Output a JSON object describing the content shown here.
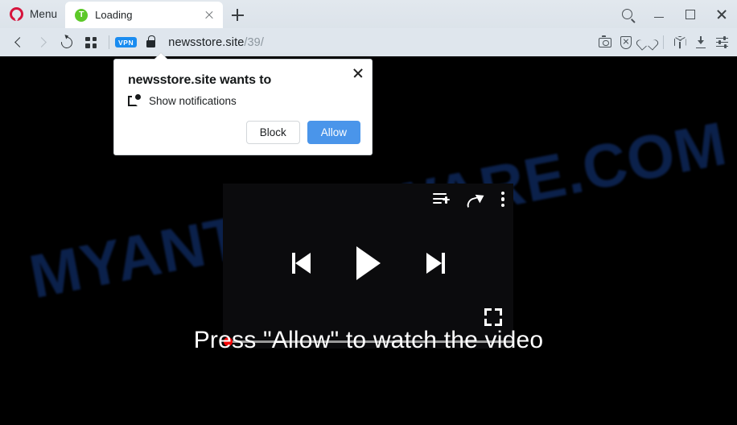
{
  "browser": {
    "menu_label": "Menu",
    "tab": {
      "title": "Loading",
      "favicon_letter": "T",
      "favicon_color": "#5cc928",
      "close_icon": "close-icon"
    },
    "new_tab_icon": "plus-icon",
    "window_controls": {
      "search_icon": "search-icon",
      "minimize_icon": "minimize-icon",
      "maximize_icon": "maximize-icon",
      "close_icon": "close-icon"
    },
    "navigation": {
      "back_icon": "chevron-left-icon",
      "forward_icon": "chevron-right-icon",
      "reload_icon": "reload-icon",
      "apps_icon": "grid-apps-icon"
    },
    "address": {
      "vpn_badge": "VPN",
      "lock_icon": "lock-icon",
      "host": "newsstore.site",
      "path": "/39/"
    },
    "toolbar_icons": [
      {
        "name": "snapshot-camera-icon"
      },
      {
        "name": "ad-blocker-shield-icon"
      },
      {
        "name": "heart-icon"
      },
      {
        "name": "cube-icon"
      },
      {
        "name": "downloads-icon"
      },
      {
        "name": "easy-setup-sliders-icon"
      }
    ]
  },
  "permission_dialog": {
    "title": "newsstore.site wants to",
    "permission_label": "Show notifications",
    "permission_icon": "notification-icon",
    "close_icon": "close-icon",
    "block_label": "Block",
    "allow_label": "Allow",
    "allow_color": "#4a95ea"
  },
  "page": {
    "watermark": "MYANTISPYWARE.COM",
    "watermark_color": "#0d2452",
    "background_color": "#000000",
    "cta_text": "Press \"Allow\" to watch the video",
    "player": {
      "playlist_add_icon": "playlist-add-icon",
      "share_icon": "share-icon",
      "more_options_icon": "more-vertical-icon",
      "previous_icon": "skip-previous-icon",
      "play_icon": "play-icon",
      "next_icon": "skip-next-icon",
      "fullscreen_icon": "fullscreen-icon",
      "progress_percent": 0,
      "thumb_color": "#f50505"
    }
  }
}
